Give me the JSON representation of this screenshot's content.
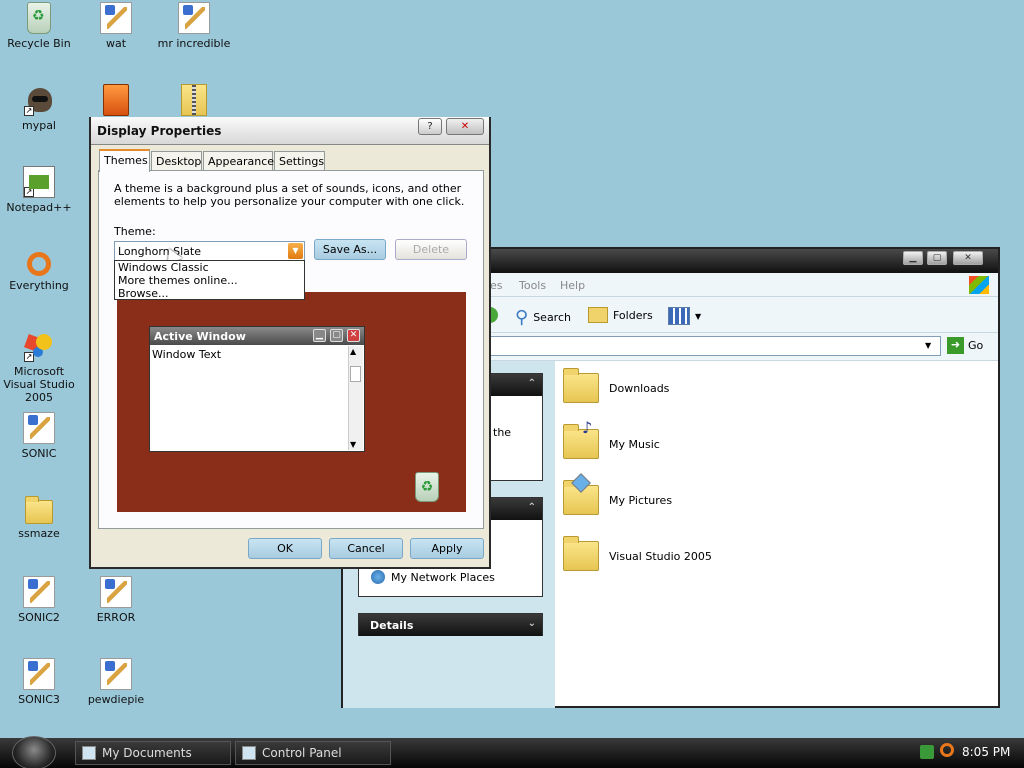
{
  "desktop": {
    "icons": [
      {
        "label": "Recycle Bin"
      },
      {
        "label": "wat"
      },
      {
        "label": "mr incredible"
      },
      {
        "label": "mypal"
      },
      {
        "label": "Notepad++"
      },
      {
        "label": "Everything"
      },
      {
        "label": "Microsoft Visual Studio 2005"
      },
      {
        "label": "SONIC"
      },
      {
        "label": "ssmaze"
      },
      {
        "label": "SONIC2"
      },
      {
        "label": "ERROR"
      },
      {
        "label": "SONIC3"
      },
      {
        "label": "pewdiepie"
      }
    ]
  },
  "display_properties": {
    "title": "Display Properties",
    "tabs": [
      "Themes",
      "Desktop",
      "Appearance",
      "Settings"
    ],
    "description": "A theme is a background plus a set of sounds, icons, and other elements to help you personalize your computer with one click.",
    "theme_label": "Theme:",
    "theme_value": "Longhorn Slate",
    "dropdown_options": [
      "Windows Classic",
      "More themes online...",
      "Browse..."
    ],
    "save_as": "Save As...",
    "delete": "Delete",
    "preview": {
      "window_title": "Active Window",
      "window_text": "Window Text"
    },
    "ok": "OK",
    "cancel": "Cancel",
    "apply": "Apply"
  },
  "explorer": {
    "menu": [
      "es",
      "Tools",
      "Help"
    ],
    "toolbar": {
      "search": "Search",
      "folders": "Folders"
    },
    "go": "Go",
    "left_panel": {
      "partial_text": "the",
      "network": "My Network Places",
      "details": "Details"
    },
    "files": [
      "Downloads",
      "My Music",
      "My Pictures",
      "Visual Studio 2005"
    ]
  },
  "taskbar": {
    "items": [
      "My Documents",
      "Control Panel"
    ],
    "clock": "8:05 PM"
  }
}
